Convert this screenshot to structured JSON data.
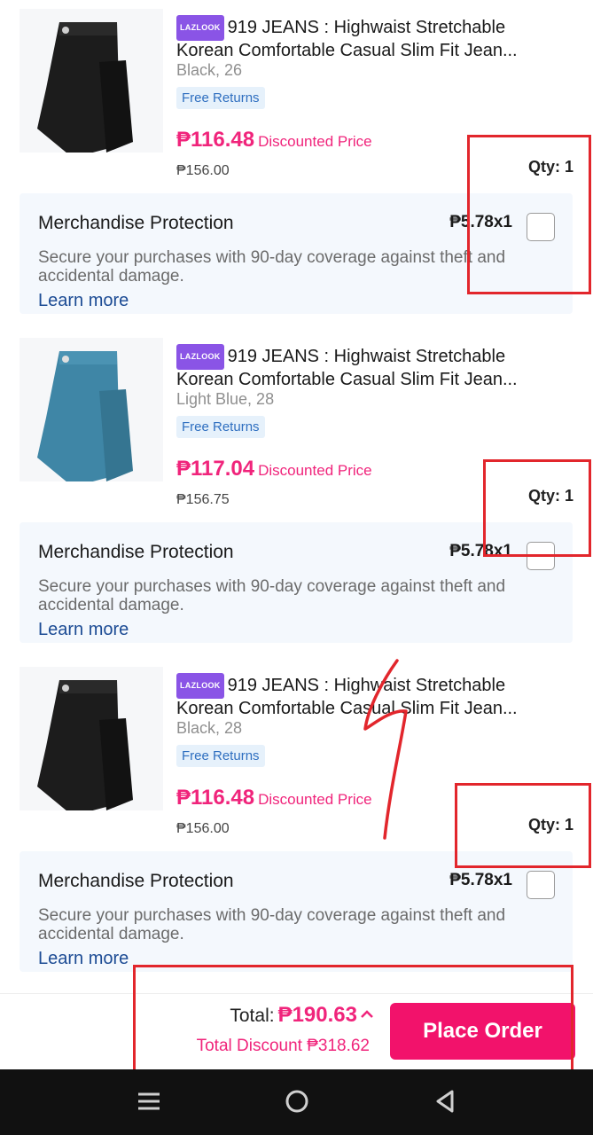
{
  "items": [
    {
      "brand_badge": "LAZLOOK",
      "title_line1": "919 JEANS : Highwaist Stretchable",
      "title_line2": "Korean Comfortable Casual Slim Fit Jean...",
      "variant": "Black, 26",
      "badge": "Free Returns",
      "price": "₱116.48",
      "price_label": "Discounted Price",
      "original_price": "₱156.00",
      "qty": "Qty: 1",
      "product_color": "#1c1c1c",
      "protection": {
        "title": "Merchandise Protection",
        "price": "₱5.78x1",
        "description": "Secure your purchases with 90-day coverage against theft and accidental damage.",
        "link": "Learn more",
        "checked": false
      }
    },
    {
      "brand_badge": "LAZLOOK",
      "title_line1": "919 JEANS : Highwaist Stretchable",
      "title_line2": "Korean Comfortable Casual Slim Fit Jean...",
      "variant": "Light Blue, 28",
      "badge": "Free Returns",
      "price": "₱117.04",
      "price_label": "Discounted Price",
      "original_price": "₱156.75",
      "qty": "Qty: 1",
      "product_color": "#3f86a6",
      "protection": {
        "title": "Merchandise Protection",
        "price": "₱5.78x1",
        "description": "Secure your purchases with 90-day coverage against theft and accidental damage.",
        "link": "Learn more",
        "checked": false
      }
    },
    {
      "brand_badge": "LAZLOOK",
      "title_line1": "919 JEANS : Highwaist Stretchable",
      "title_line2": "Korean Comfortable Casual Slim Fit Jean...",
      "variant": "Black, 28",
      "badge": "Free Returns",
      "price": "₱116.48",
      "price_label": "Discounted Price",
      "original_price": "₱156.00",
      "qty": "Qty: 1",
      "product_color": "#1c1c1c",
      "protection": {
        "title": "Merchandise Protection",
        "price": "₱5.78x1",
        "description": "Secure your purchases with 90-day coverage against theft and accidental damage.",
        "link": "Learn more",
        "checked": false
      }
    }
  ],
  "footer": {
    "total_label": "Total:",
    "total_amount": "₱190.63",
    "total_discount": "Total Discount ₱318.62",
    "place_order": "Place Order"
  },
  "nav": {
    "icons": [
      "menu-icon",
      "home-icon",
      "back-icon"
    ]
  },
  "colors": {
    "accent": "#f0247b",
    "button": "#f2126b",
    "annotation": "#e2262c",
    "link": "#1c4b94"
  }
}
